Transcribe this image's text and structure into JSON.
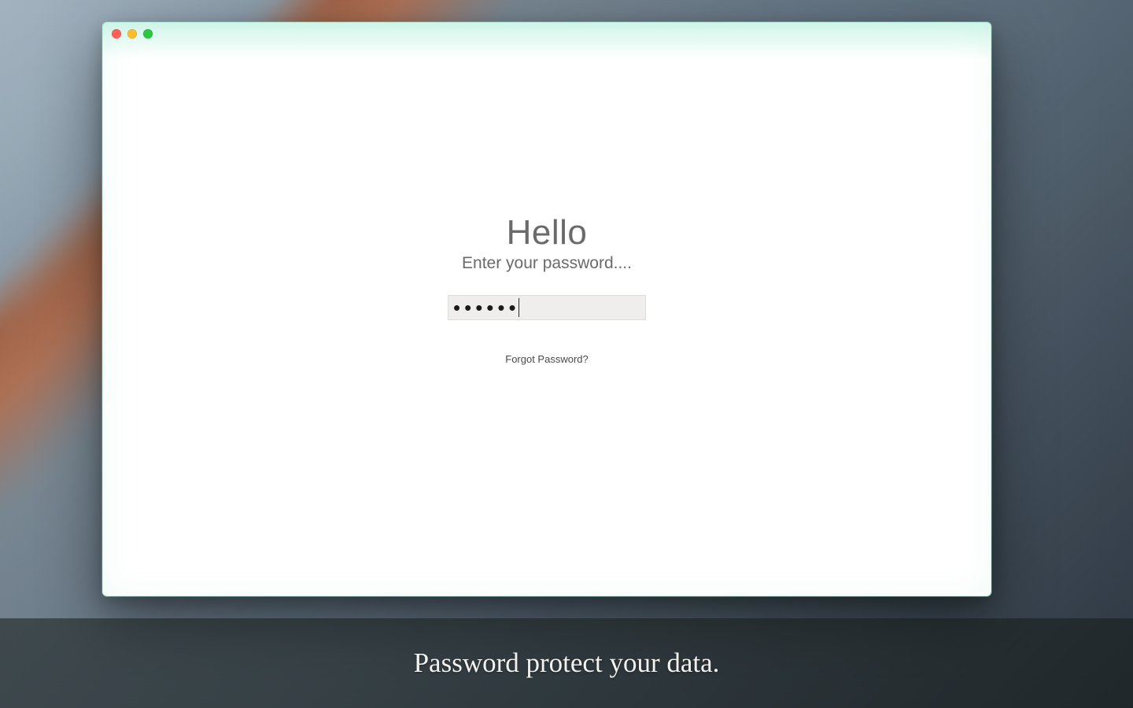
{
  "greeting": "Hello",
  "prompt": "Enter your password....",
  "password": {
    "masked_value": "••••••"
  },
  "forgot_link_label": "Forgot Password?",
  "caption": "Password protect your data."
}
